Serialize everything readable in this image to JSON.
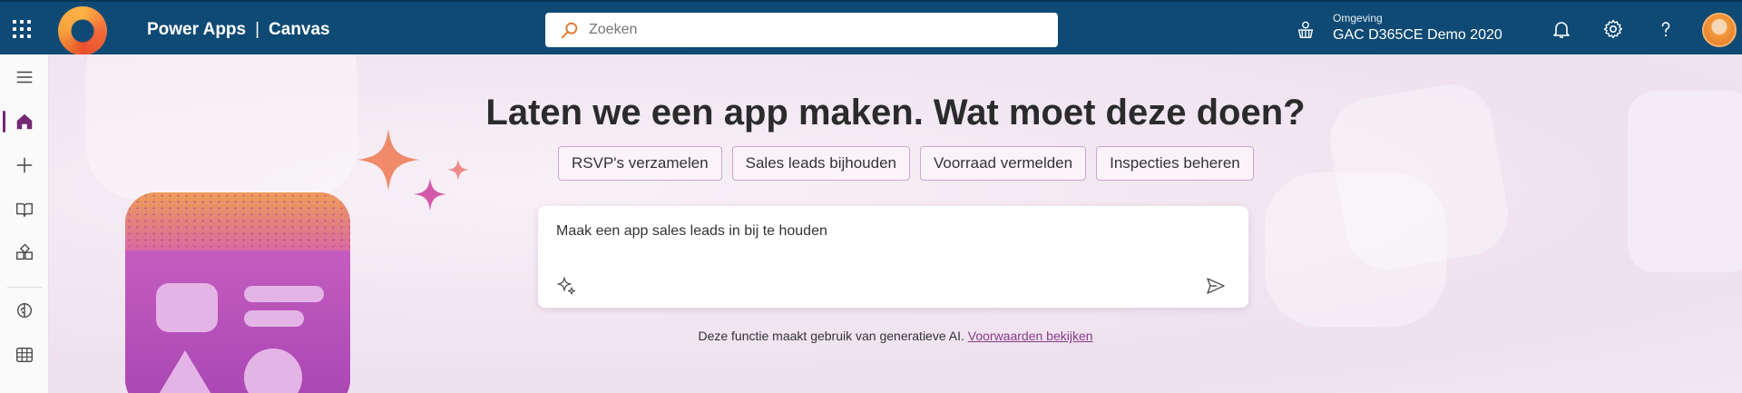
{
  "topbar": {
    "app_name": "Power Apps",
    "separator": "|",
    "product": "Canvas",
    "search_placeholder": "Zoeken",
    "environment_label": "Omgeving",
    "environment_name": "GAC D365CE Demo 2020"
  },
  "rail": {
    "items": [
      "menu",
      "home",
      "create",
      "learn",
      "apps",
      "ai-hub",
      "tables"
    ],
    "active": "home"
  },
  "hero": {
    "heading": "Laten we een app maken. Wat moet deze doen?",
    "suggestions": [
      "RSVP's verzamelen",
      "Sales leads bijhouden",
      "Voorraad vermelden",
      "Inspecties beheren"
    ],
    "prompt_value": "Maak een app sales leads in bij te houden",
    "disclaimer_text": "Deze functie maakt gebruik van generatieve AI.",
    "disclaimer_link": "Voorwaarden bekijken"
  },
  "colors": {
    "topbar": "#0f4a75",
    "accent": "#742774",
    "chip_border": "#c9a7cf",
    "link": "#8a3b8a"
  }
}
